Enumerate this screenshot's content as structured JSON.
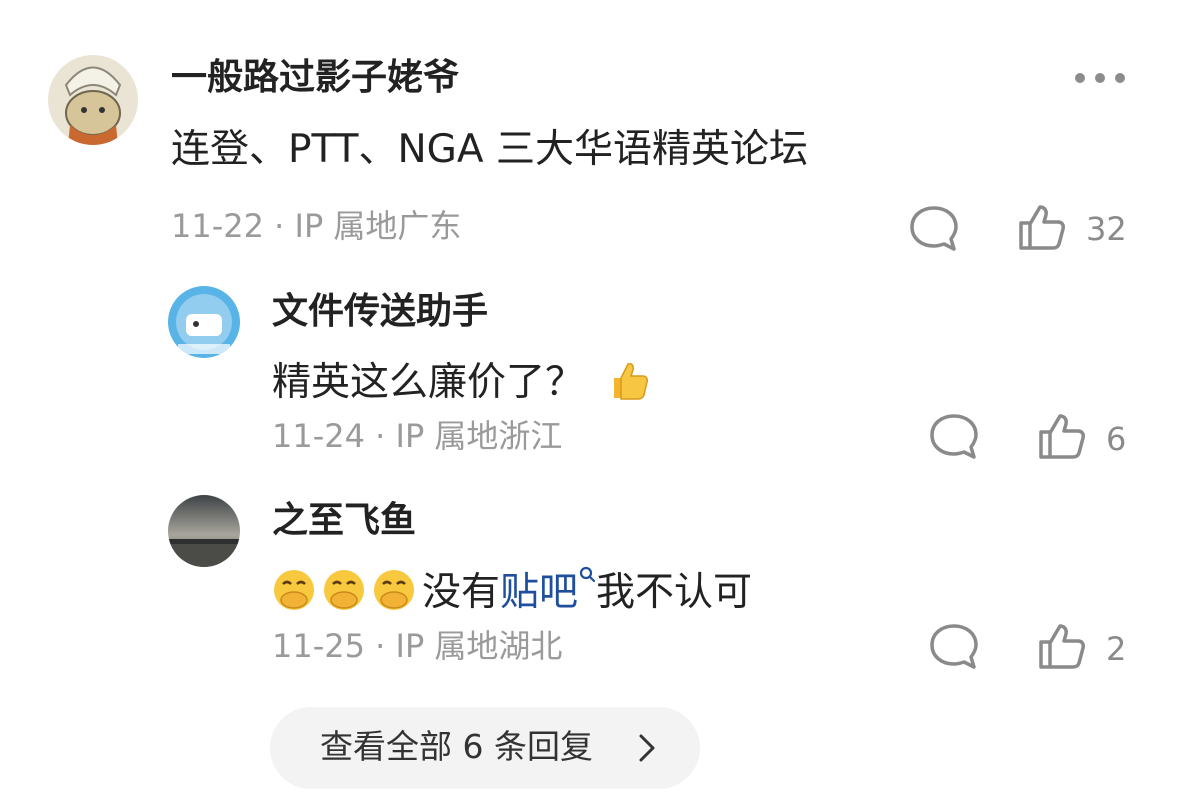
{
  "comment": {
    "author": "一般路过影子姥爷",
    "text": "连登、PTT、NGA 三大华语精英论坛",
    "date": "11-22",
    "location": "IP 属地广东",
    "likes": "32",
    "more_icon": "more-dots-icon"
  },
  "replies": [
    {
      "author": "文件传送助手",
      "text": "精英这么廉价了？",
      "emoji": "thumbs-up-emoji",
      "date": "11-24",
      "location": "IP 属地浙江",
      "likes": "6"
    },
    {
      "author": "之至飞鱼",
      "emoji": "face-with-hand-over-mouth-emoji",
      "text_before": "没有",
      "link": "贴吧",
      "text_after": "我不认可",
      "date": "11-25",
      "location": "IP 属地湖北",
      "likes": "2"
    }
  ],
  "expand_replies": "查看全部 6 条回复",
  "sep": "·",
  "colors": {
    "text": "#222222",
    "meta": "#9a9a9a",
    "link": "#1f4e9c",
    "pill_bg": "#f3f3f3"
  }
}
